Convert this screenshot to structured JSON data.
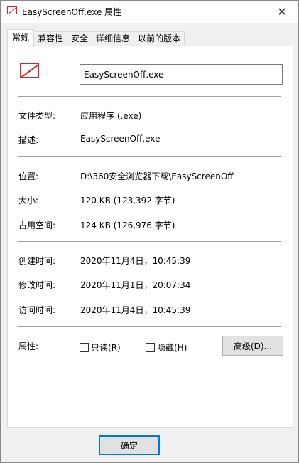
{
  "window": {
    "title": "EasyScreenOff.exe 属性",
    "close_glyph": "✕"
  },
  "tabs": [
    {
      "label": "常规",
      "active": true
    },
    {
      "label": "兼容性",
      "active": false
    },
    {
      "label": "安全",
      "active": false
    },
    {
      "label": "详细信息",
      "active": false
    },
    {
      "label": "以前的版本",
      "active": false
    }
  ],
  "general": {
    "file_name": "EasyScreenOff.exe",
    "file_type_label": "文件类型:",
    "file_type_value": "应用程序 (.exe)",
    "description_label": "描述:",
    "description_value": "EasyScreenOff.exe",
    "location_label": "位置:",
    "location_value": "D:\\360安全浏览器下载\\EasyScreenOff",
    "size_label": "大小:",
    "size_value": "120 KB (123,392 字节)",
    "size_on_disk_label": "占用空间:",
    "size_on_disk_value": "124 KB (126,976 字节)",
    "created_label": "创建时间:",
    "created_value": "2020年11月4日，10:45:39",
    "modified_label": "修改时间:",
    "modified_value": "2020年11月1日，20:07:34",
    "accessed_label": "访问时间:",
    "accessed_value": "2020年11月4日，10:45:39",
    "attributes_label": "属性:",
    "readonly_label": "只读(R)",
    "readonly_checked": false,
    "hidden_label": "隐藏(H)",
    "hidden_checked": false,
    "advanced_button": "高级(D)..."
  },
  "footer": {
    "ok_button": "确定"
  },
  "colors": {
    "accent": "#0078d7",
    "icon_red": "#dd2222"
  }
}
